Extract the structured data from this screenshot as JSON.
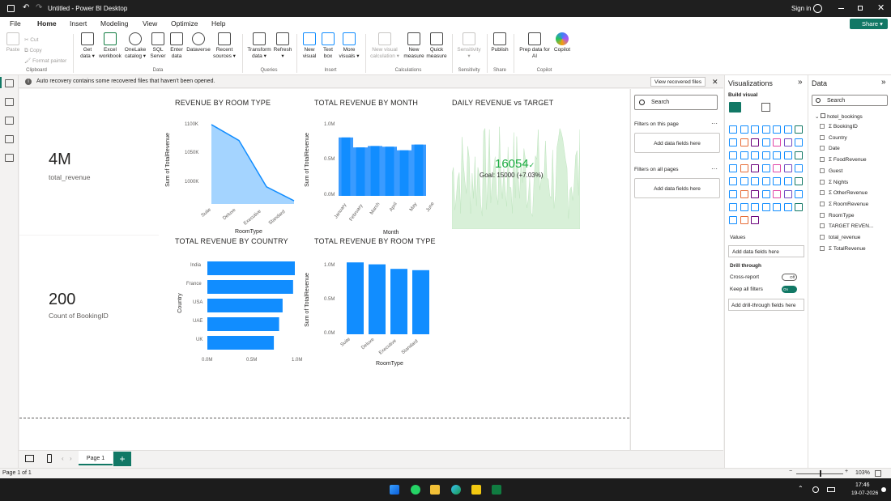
{
  "titlebar": {
    "title": "Untitled - Power BI Desktop",
    "signin": "Sign in"
  },
  "menu": {
    "file": "File",
    "home": "Home",
    "insert": "Insert",
    "modeling": "Modeling",
    "view": "View",
    "optimize": "Optimize",
    "help": "Help",
    "share": "Share"
  },
  "ribbon": {
    "paste": "Paste",
    "cut": "Cut",
    "copy": "Copy",
    "format_painter": "Format painter",
    "get_data": [
      "Get",
      "data ▾"
    ],
    "excel": [
      "Excel",
      "workbook"
    ],
    "onelake": [
      "OneLake",
      "catalog ▾"
    ],
    "sql": [
      "SQL",
      "Server"
    ],
    "enter": [
      "Enter",
      "data"
    ],
    "dataverse": [
      "Dataverse",
      ""
    ],
    "recent": [
      "Recent",
      "sources ▾"
    ],
    "transform": [
      "Transform",
      "data ▾"
    ],
    "refresh": [
      "Refresh",
      "▾"
    ],
    "new_visual": [
      "New",
      "visual"
    ],
    "text_box": [
      "Text",
      "box"
    ],
    "more_visuals": [
      "More",
      "visuals ▾"
    ],
    "new_calc": [
      "New visual",
      "calculation ▾"
    ],
    "new_measure": [
      "New",
      "measure"
    ],
    "quick_measure": [
      "Quick",
      "measure"
    ],
    "sensitivity": [
      "Sensitivity",
      "▾"
    ],
    "publish": [
      "Publish",
      ""
    ],
    "copilot": [
      "Prep data for",
      "AI"
    ],
    "copilot2": [
      "Copilot",
      ""
    ],
    "groups": {
      "clipboard": "Clipboard",
      "data": "Data",
      "queries": "Queries",
      "insert": "Insert",
      "calculations": "Calculations",
      "sensitivity": "Sensitivity",
      "share": "Share",
      "copilot": "Copilot"
    }
  },
  "infobar": {
    "message": "Auto recovery contains some recovered files that haven't been opened.",
    "button": "View recovered files"
  },
  "cards": [
    {
      "value": "4M",
      "label": "total_revenue"
    },
    {
      "value": "200",
      "label": "Count of BookingID"
    }
  ],
  "chart_data": [
    {
      "type": "area",
      "title": "REVENUE BY ROOM TYPE",
      "xlabel": "RoomType",
      "ylabel": "Sum of TotalRevenue",
      "categories": [
        "Suite",
        "Deluxe",
        "Executive",
        "Standard"
      ],
      "values": [
        1110000,
        1085000,
        1012000,
        990000
      ],
      "yticks": [
        "1100K",
        "1050K",
        "1000K"
      ],
      "ylim": [
        985000,
        1115000
      ]
    },
    {
      "type": "bar",
      "title": "TOTAL REVENUE BY MONTH",
      "xlabel": "Month",
      "ylabel": "Sum of TotalRevenue",
      "categories": [
        "January",
        "February",
        "March",
        "April",
        "May",
        "June"
      ],
      "values": [
        0.82,
        0.68,
        0.7,
        0.69,
        0.64,
        0.72
      ],
      "yticks": [
        "1.0M",
        "0.5M",
        "0.0M"
      ],
      "ylim": [
        0,
        1.0
      ]
    },
    {
      "type": "line",
      "title": "DAILY REVENUE vs TARGET",
      "kpi_value": "16054",
      "kpi_goal": "Goal: 15000 (+7.03%)"
    },
    {
      "type": "bar",
      "orientation": "horizontal",
      "title": "TOTAL REVENUE BY COUNTRY",
      "xlabel": "",
      "ylabel": "Country",
      "categories": [
        "India",
        "France",
        "USA",
        "UAE",
        "UK"
      ],
      "values": [
        1.0,
        0.98,
        0.86,
        0.82,
        0.76
      ],
      "xticks": [
        "0.0M",
        "0.5M",
        "1.0M"
      ],
      "xlim": [
        0,
        1.0
      ]
    },
    {
      "type": "bar",
      "title": "TOTAL REVENUE BY ROOM TYPE",
      "xlabel": "RoomType",
      "ylabel": "Sum of TotalRevenue",
      "categories": [
        "Suite",
        "Deluxe",
        "Executive",
        "Standard"
      ],
      "values": [
        1.11,
        1.08,
        1.01,
        0.99
      ],
      "yticks": [
        "1.0M",
        "0.5M",
        "0.0M"
      ],
      "ylim": [
        0,
        1.25
      ]
    }
  ],
  "filters": {
    "search": "Search",
    "on_page": "Filters on this page",
    "on_all": "Filters on all pages",
    "add": "Add data fields here"
  },
  "viz": {
    "title": "Visualizations",
    "build": "Build visual",
    "values": "Values",
    "add": "Add data fields here",
    "drill": "Drill through",
    "cross": "Cross-report",
    "cross_state": "Off",
    "keep": "Keep all filters",
    "keep_state": "On",
    "drill_add": "Add drill-through fields here"
  },
  "data": {
    "title": "Data",
    "search": "Search",
    "table": "hotel_bookings",
    "fields": [
      "Σ BookingID",
      "Country",
      "Date",
      "Σ FoodRevenue",
      "Guest",
      "Σ Nights",
      "Σ OtherRevenue",
      "Σ RoomRevenue",
      "RoomType",
      "TARGET REVEN...",
      "total_revenue",
      "Σ TotalRevenue"
    ]
  },
  "pages": {
    "tab": "Page 1",
    "status": "Page 1 of 1",
    "zoom": "103%"
  },
  "taskbar": {
    "time": "17:46",
    "date": "19-07-2026"
  },
  "colors": {
    "accent": "#118dff",
    "kpi": "#1aab40",
    "green": "#117865"
  }
}
